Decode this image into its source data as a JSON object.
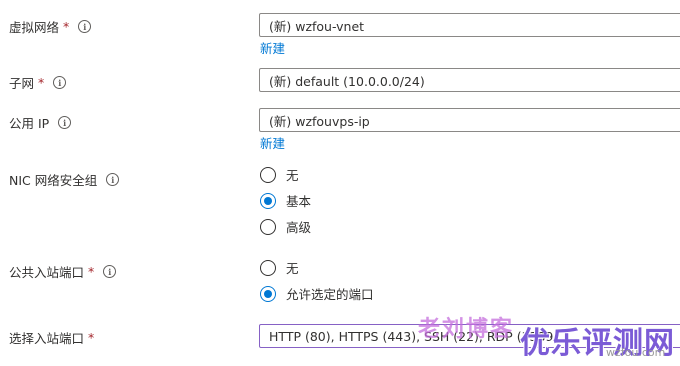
{
  "form": {
    "vnet": {
      "label": "虚拟网络",
      "required": "*",
      "value": "(新) wzfou-vnet",
      "create_link": "新建"
    },
    "subnet": {
      "label": "子网",
      "required": "*",
      "value": "(新) default (10.0.0.0/24)"
    },
    "public_ip": {
      "label": "公用 IP",
      "value": "(新) wzfouvps-ip",
      "create_link": "新建"
    },
    "nic_nsg": {
      "label": "NIC 网络安全组",
      "options": [
        "无",
        "基本",
        "高级"
      ],
      "selected": "基本"
    },
    "inbound_ports": {
      "label": "公共入站端口",
      "required": "*",
      "options": [
        "无",
        "允许选定的端口"
      ],
      "selected": "允许选定的端口"
    },
    "select_ports": {
      "label": "选择入站端口",
      "required": "*",
      "value": "HTTP (80), HTTPS (443), SSH (22), RDP (3389)"
    }
  },
  "watermark": {
    "blog": "老刘博客",
    "site": "优乐评测网",
    "domain": "wzfou.com"
  },
  "colors": {
    "accent": "#0078d4",
    "required": "#a4262c",
    "focus_border": "#8661c5"
  }
}
